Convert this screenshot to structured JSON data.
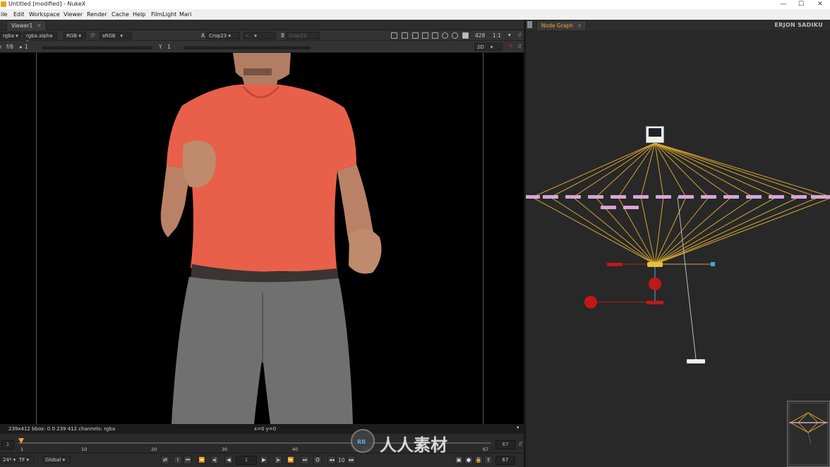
{
  "window": {
    "title": "Untitled [modified] - NukeX",
    "minimize": "—",
    "maximize": "☐",
    "close": "✕"
  },
  "menu": [
    "ile",
    "Edit",
    "Workspace",
    "Viewer",
    "Render",
    "Cache",
    "Help",
    "FilmLight",
    "Mari"
  ],
  "viewer_tab": {
    "label": "Viewer1",
    "close": "✕"
  },
  "viewer_toolbar": {
    "channels": "rgba",
    "alpha": "rgba.alpha",
    "colorspace_rgb": "RGB",
    "ip": "IP",
    "lut": "sRGB",
    "input_a_label": "A",
    "input_a": "Crop23",
    "blend": "-",
    "input_b_label": "B",
    "input_b": "Crop23",
    "zoom": "428",
    "ratio": "1:1"
  },
  "viewer_toolbar2": {
    "fstop": "f/8",
    "gain_value": "1",
    "gamma_label": "Y",
    "gamma_value": "1",
    "mode": "2D"
  },
  "viewer_status": {
    "info": "239x412   bbox: 0 0 239 412   channels: rgba",
    "coords": "x=0 y=0"
  },
  "timeline": {
    "start": "1",
    "end": "67",
    "ticks": [
      "1",
      "10",
      "20",
      "30",
      "40",
      "50",
      "60",
      "67"
    ],
    "current_frame_fraction": 0.0
  },
  "transport": {
    "fps": "24*",
    "tf": "TF",
    "scope": "Global",
    "frame": "1",
    "increment": "10",
    "end_frame": "67"
  },
  "node_graph": {
    "tab": "Node Graph",
    "close": "✕",
    "author": "ERJON SADIKU"
  },
  "watermark": "人人素材",
  "colors": {
    "node_line": "#d6a531",
    "node_pink": "#d7a6d6",
    "node_red": "#c01818",
    "accent_orange": "#f0a234",
    "shirt": "#e8604a"
  }
}
